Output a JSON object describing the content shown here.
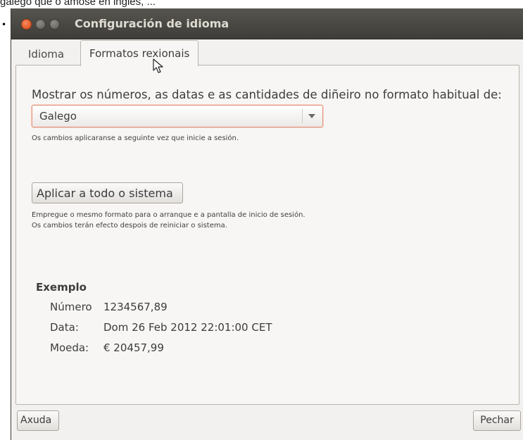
{
  "caption": "galego que o amose en inglés, ...",
  "window": {
    "title": "Configuración de idioma"
  },
  "tabs": [
    {
      "label": "Idioma",
      "active": false
    },
    {
      "label": "Formatos rexionais",
      "active": true
    }
  ],
  "formats": {
    "heading": "Mostrar os números, as datas e as cantidades de diñeiro no formato habitual de:",
    "combo_value": "Galego",
    "combo_note": "Os cambios aplicaranse a seguinte vez que inicie a sesión.",
    "apply_button": "Aplicar a todo o sistema",
    "apply_note_1": "Empregue o mesmo formato para o arranque e a pantalla de inicio de sesión.",
    "apply_note_2": "Os cambios terán efecto despois de reiniciar o sistema."
  },
  "example": {
    "title": "Exemplo",
    "rows": [
      {
        "label": "Número",
        "value": "1234567,89"
      },
      {
        "label": "Data:",
        "value": "Dom 26 Feb 2012 22:01:00 CET"
      },
      {
        "label": "Moeda:",
        "value": "€ 20457,99"
      }
    ]
  },
  "buttons": {
    "help": "Axuda",
    "close": "Pechar"
  },
  "colors": {
    "titlebar": "#3e3d39",
    "title_text": "#dfdbd2",
    "close_button": "#df4a16",
    "focus_border": "#e4937a",
    "dialog_bg": "#f2f1ef"
  }
}
